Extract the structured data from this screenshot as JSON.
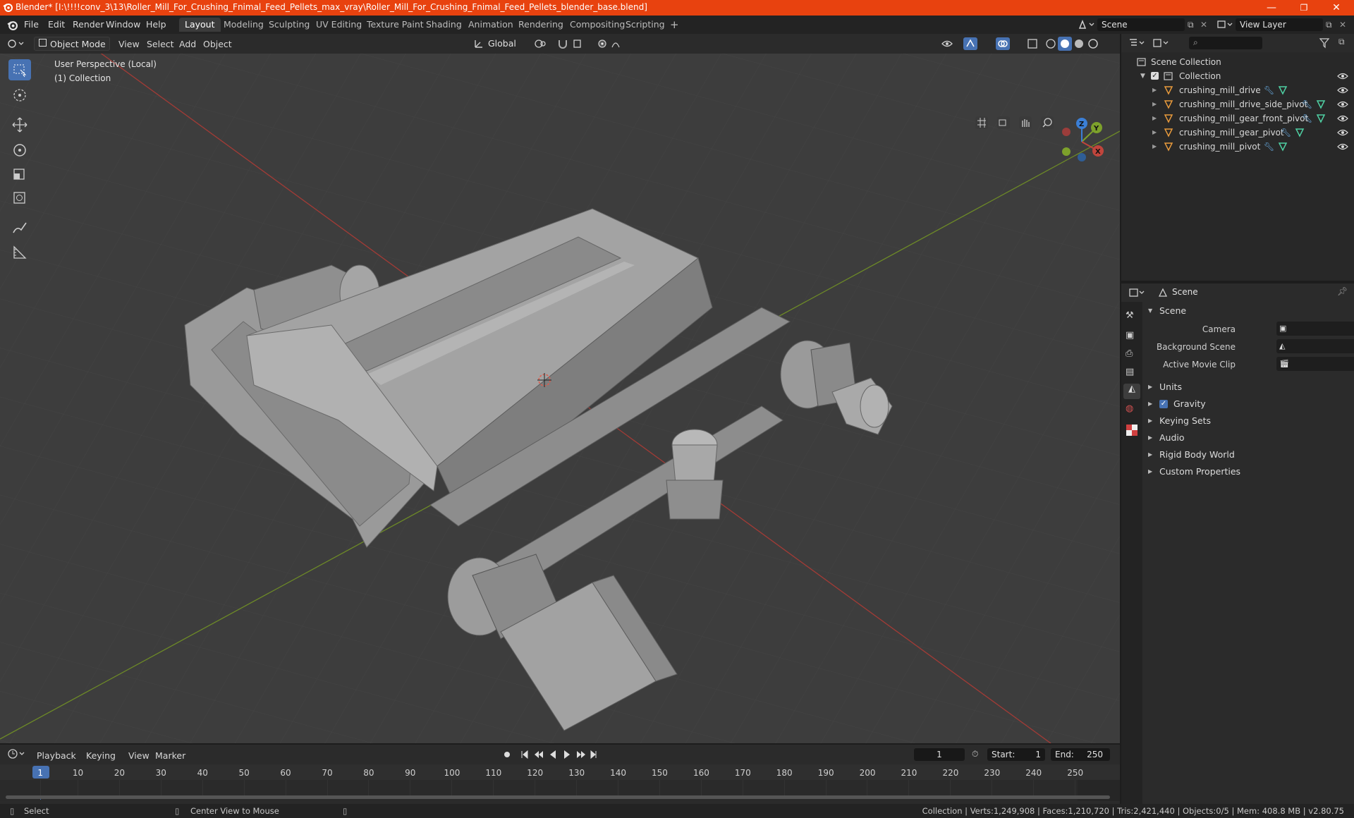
{
  "window": {
    "title": "Blender* [I:\\!!!!conv_3\\13\\Roller_Mill_For_Crushing_Fnimal_Feed_Pellets_max_vray\\Roller_Mill_For_Crushing_Fnimal_Feed_Pellets_blender_base.blend]",
    "minimize": "—",
    "restore": "❐",
    "close": "✕"
  },
  "menu": {
    "items": [
      "File",
      "Edit",
      "Render",
      "Window",
      "Help"
    ],
    "workspaces": [
      "Layout",
      "Modeling",
      "Sculpting",
      "UV Editing",
      "Texture Paint",
      "Shading",
      "Animation",
      "Rendering",
      "Compositing",
      "Scripting"
    ],
    "add_workspace": "+",
    "scene_name": "Scene",
    "view_layer": "View Layer"
  },
  "viewport_header": {
    "mode": "Object Mode",
    "menus": [
      "View",
      "Select",
      "Add",
      "Object"
    ],
    "orientation": "Global"
  },
  "viewport": {
    "perspective": "User Perspective (Local)",
    "collection": "(1) Collection",
    "gizmo": {
      "x": "X",
      "y": "Y",
      "z": "Z"
    }
  },
  "outliner": {
    "root": "Scene Collection",
    "collection": "Collection",
    "objects": [
      "crushing_mill_drive",
      "crushing_mill_drive_side_pivot",
      "crushing_mill_gear_front_pivot",
      "crushing_mill_gear_pivot",
      "crushing_mill_pivot"
    ]
  },
  "properties": {
    "context": "Scene",
    "panel": "Scene",
    "fields": [
      {
        "label": "Camera",
        "value": ""
      },
      {
        "label": "Background Scene",
        "value": ""
      },
      {
        "label": "Active Movie Clip",
        "value": ""
      }
    ],
    "sections": [
      "Units",
      "Gravity",
      "Keying Sets",
      "Audio",
      "Rigid Body World",
      "Custom Properties"
    ],
    "gravity_checked": true
  },
  "timeline": {
    "menus": [
      "Playback",
      "Keying",
      "View",
      "Marker"
    ],
    "current_frame": "1",
    "start_label": "Start:",
    "start": "1",
    "end_label": "End:",
    "end": "250",
    "ticks": [
      "1",
      "10",
      "20",
      "30",
      "40",
      "50",
      "60",
      "70",
      "80",
      "90",
      "100",
      "110",
      "120",
      "130",
      "140",
      "150",
      "160",
      "170",
      "180",
      "190",
      "200",
      "210",
      "220",
      "230",
      "240",
      "250"
    ]
  },
  "statusbar": {
    "select": "Select",
    "center": "Center View to Mouse",
    "stats": "Collection | Verts:1,249,908 | Faces:1,210,720 | Tris:2,421,440 | Objects:0/5 | Mem: 408.8 MB | v2.80.75"
  },
  "colors": {
    "titlebar": "#e8420f",
    "accent": "#4772b3",
    "viewport_bg": "#3d3d3d",
    "x_axis": "#c0453c",
    "y_axis": "#7da12b",
    "z_axis": "#3b7fd6"
  }
}
